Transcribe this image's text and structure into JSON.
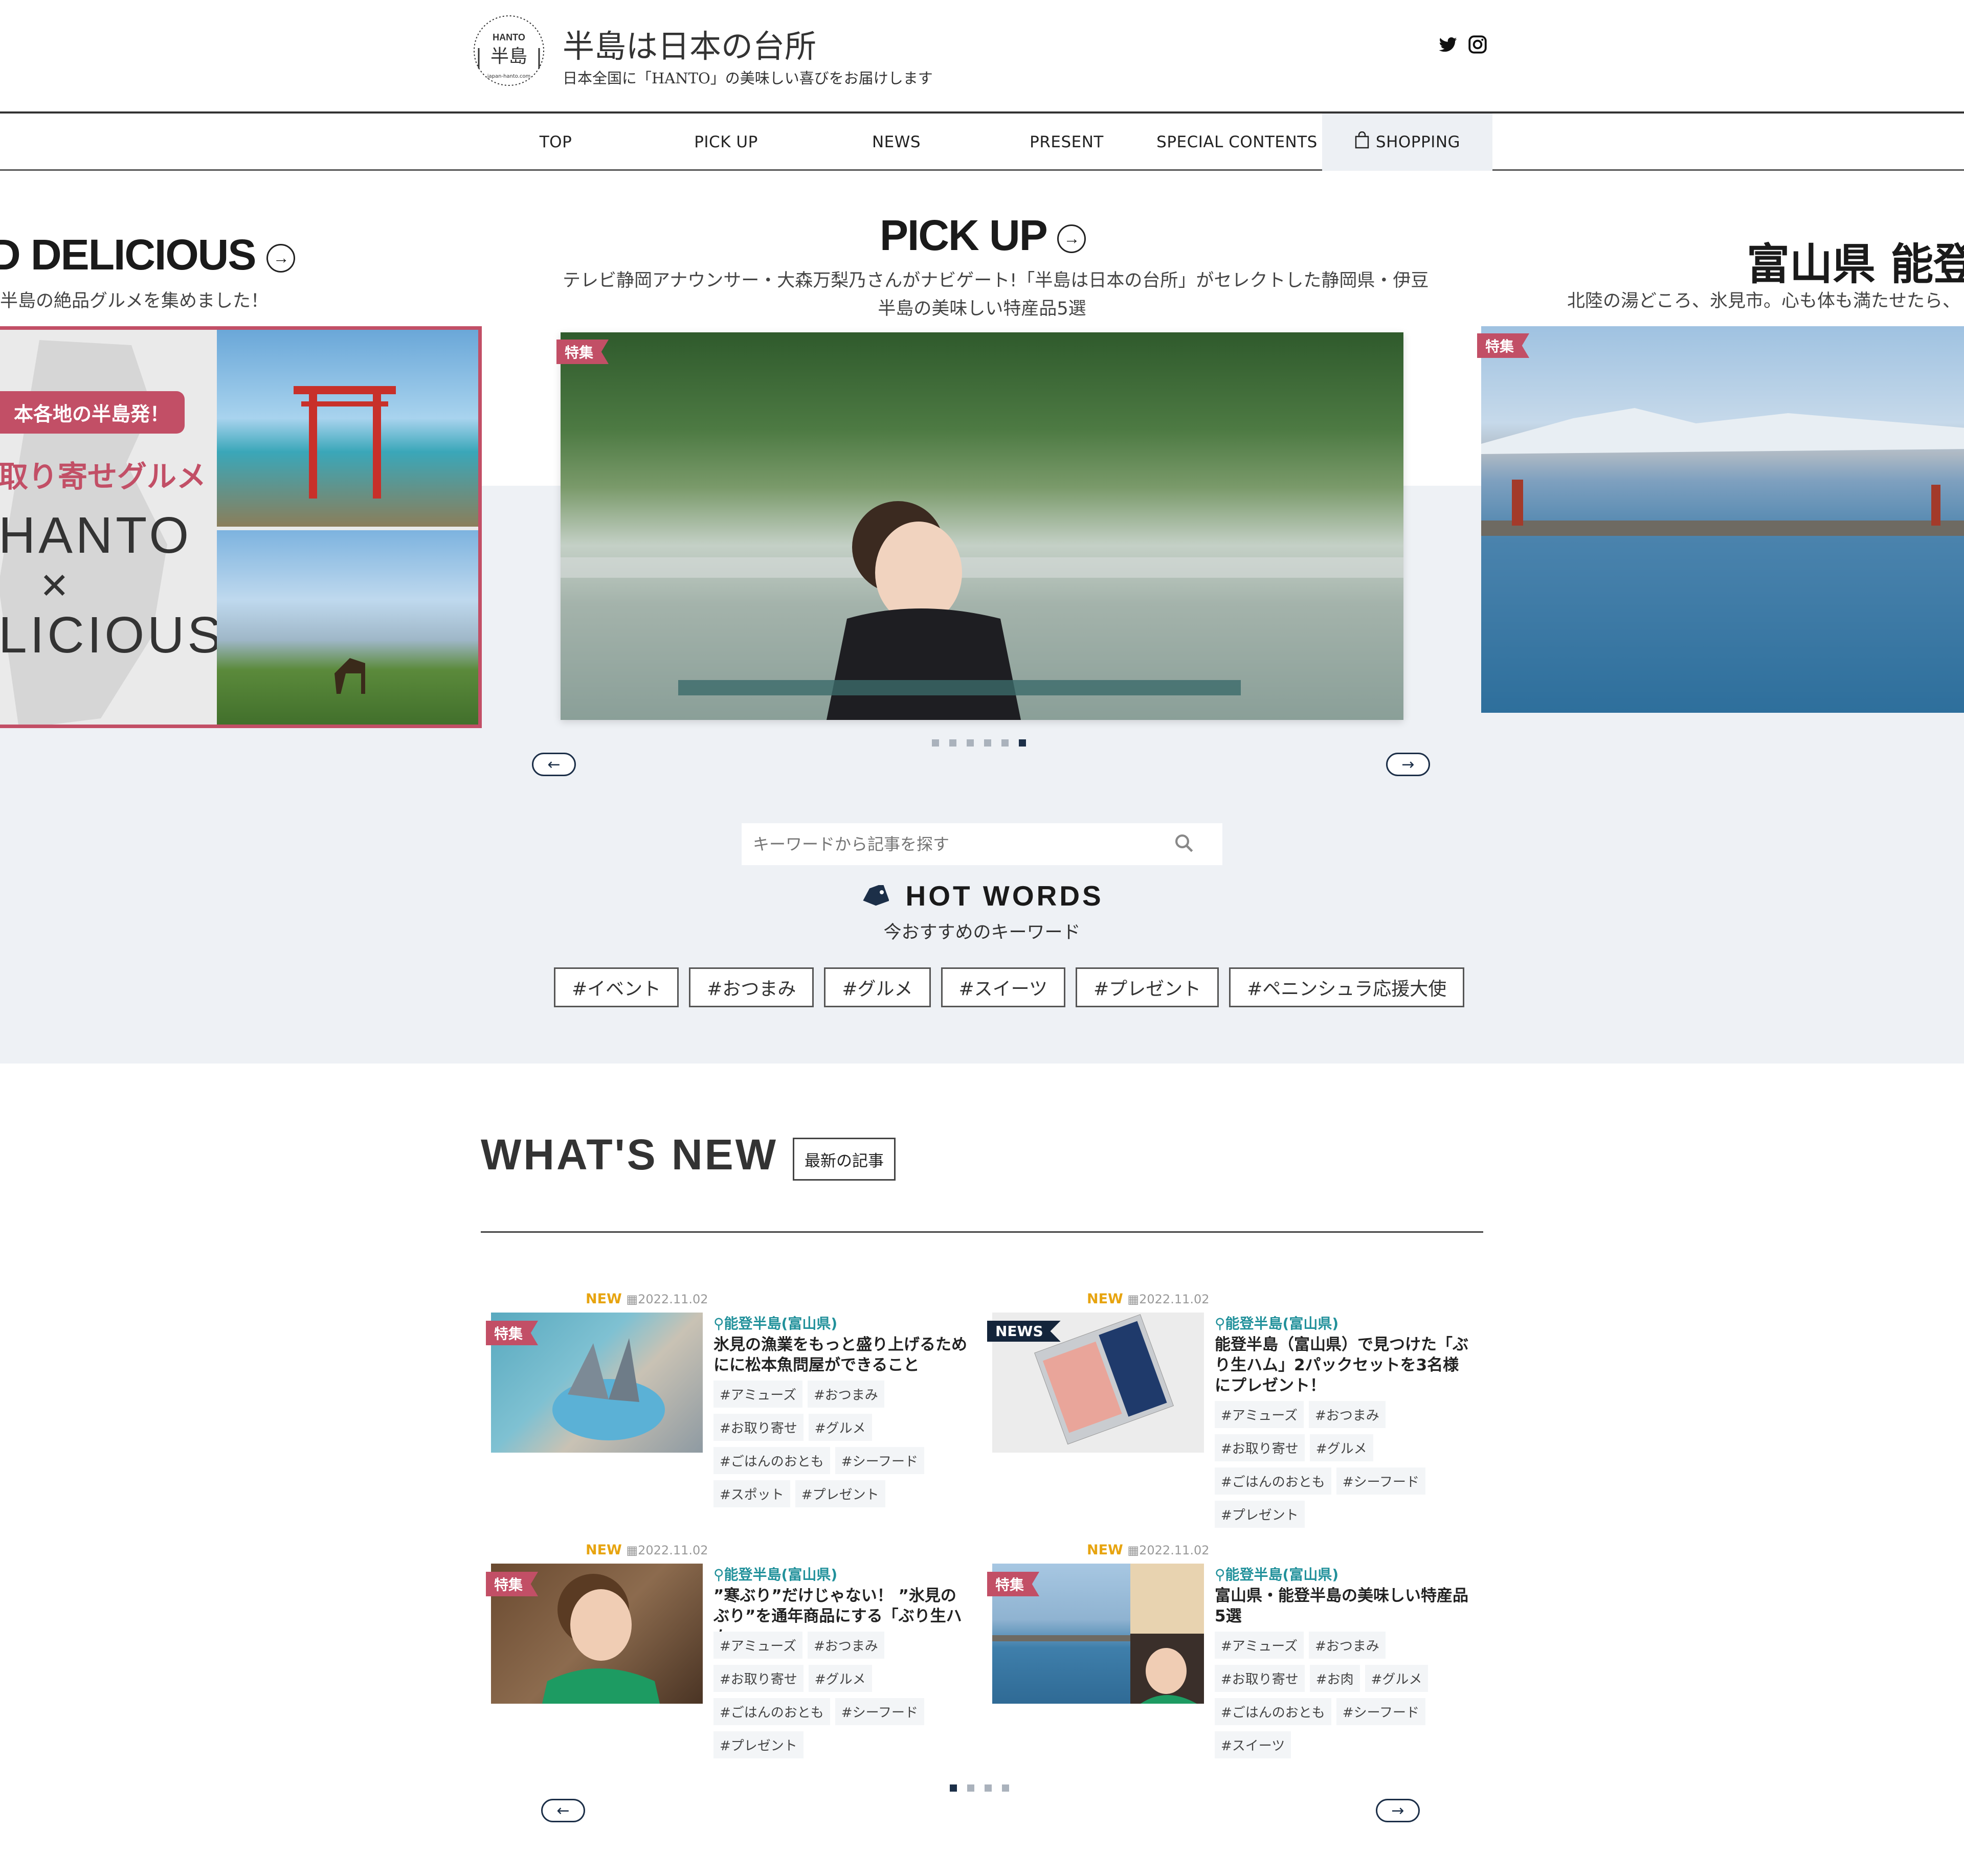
{
  "header": {
    "logo_text": "HANTO 半島",
    "title": "半島は日本の台所",
    "tagline": "日本全国に「HANTO」の美味しい喜びをお届けします",
    "social": [
      "twitter-icon",
      "instagram-icon"
    ]
  },
  "nav": {
    "items": [
      {
        "label": "TOP"
      },
      {
        "label": "PICK UP"
      },
      {
        "label": "NEWS"
      },
      {
        "label": "PRESENT"
      },
      {
        "label": "SPECIAL CONTENTS"
      },
      {
        "label": "SHOPPING",
        "icon": "shopping-bag-icon"
      }
    ]
  },
  "carousel": {
    "left": {
      "heading": "D DELICIOUS",
      "subtitle": "半島の絶品グルメを集めました！",
      "banner_ribbon": "本各地の半島発！",
      "banner_line1": "取り寄せグルメ",
      "banner_line2": "HANTO",
      "banner_line3": "LICIOUS"
    },
    "center": {
      "heading": "PICK UP",
      "subtitle_line1": "テレビ静岡アナウンサー・大森万梨乃さんがナビゲート!「半島は日本の台所」がセレクトした静岡県・伊豆",
      "subtitle_line2": "半島の美味しい特産品5選",
      "tag": "特集"
    },
    "right": {
      "heading": "富山県 能登半",
      "subtitle": "北陸の湯どころ、氷見市。心も体も満たせたら、",
      "tag": "特集"
    },
    "dots_total": 6,
    "dots_active": 6,
    "prev": "←",
    "next": "→"
  },
  "search": {
    "placeholder": "キーワードから記事を探す"
  },
  "hot_words": {
    "title": "HOT WORDS",
    "subtitle": "今おすすめのキーワード",
    "tags": [
      "#イベント",
      "#おつまみ",
      "#グルメ",
      "#スイーツ",
      "#プレゼント",
      "#ペニンシュラ応援大使"
    ]
  },
  "whats_new": {
    "title": "WHAT'S NEW",
    "badge": "最新の記事",
    "articles": [
      {
        "new": "NEW",
        "date": "2022.11.02",
        "tag": "特集",
        "location": "能登半島(富山県)",
        "title": "氷見の漁業をもっと盛り上げるためにに松本魚問屋ができること",
        "tags": [
          "#アミューズ",
          "#おつまみ",
          "#お取り寄せ",
          "#グルメ",
          "#ごはんのおとも",
          "#シーフード",
          "#スポット",
          "#プレゼント"
        ]
      },
      {
        "new": "NEW",
        "date": "2022.11.02",
        "tag": "NEWS",
        "location": "能登半島(富山県)",
        "title": "能登半島（富山県）で見つけた「ぶり生ハム」2パックセットを3名様にプレゼント！",
        "tags": [
          "#アミューズ",
          "#おつまみ",
          "#お取り寄せ",
          "#グルメ",
          "#ごはんのおとも",
          "#シーフード",
          "#プレゼント"
        ]
      },
      {
        "new": "NEW",
        "date": "2022.11.02",
        "tag": "特集",
        "location": "能登半島(富山県)",
        "title": "”寒ぶり”だけじゃない！ ”氷見のぶり”を通年商品にする「ぶり生ハム」",
        "tags": [
          "#アミューズ",
          "#おつまみ",
          "#お取り寄せ",
          "#グルメ",
          "#ごはんのおとも",
          "#シーフード",
          "#プレゼント"
        ]
      },
      {
        "new": "NEW",
        "date": "2022.11.02",
        "tag": "特集",
        "location": "能登半島(富山県)",
        "title": "富山県・能登半島の美味しい特産品5選",
        "tags": [
          "#アミューズ",
          "#おつまみ",
          "#お取り寄せ",
          "#お肉",
          "#グルメ",
          "#ごはんのおとも",
          "#シーフード",
          "#スイーツ"
        ]
      }
    ],
    "dots_total": 4,
    "dots_active": 1,
    "prev": "←",
    "next": "→"
  },
  "colors": {
    "accent_tag": "#c24f66",
    "news_tag": "#14253b",
    "location": "#22919b",
    "new_label": "#e7a410",
    "band_bg": "#eef1f5"
  }
}
